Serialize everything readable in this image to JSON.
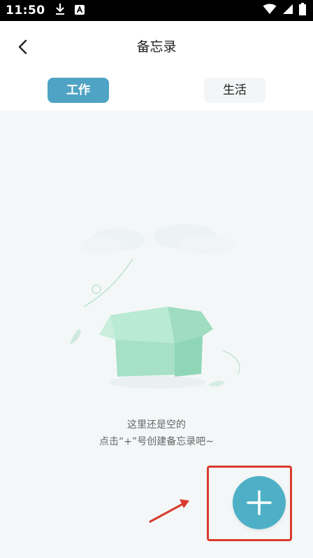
{
  "status_bar": {
    "time": "11:50",
    "icons_left": [
      "download-icon",
      "accessibility-icon"
    ],
    "icons_right": [
      "wifi-icon",
      "signal-icon",
      "battery-icon"
    ]
  },
  "header": {
    "title": "备忘录",
    "back_icon": "chevron-left-icon"
  },
  "tabs": [
    {
      "label": "工作",
      "active": true
    },
    {
      "label": "生活",
      "active": false
    }
  ],
  "empty_state": {
    "line1": "这里还是空的",
    "line2": "点击“+”号创建备忘录吧~"
  },
  "fab": {
    "icon": "plus-icon"
  },
  "colors": {
    "accent": "#4fa3c4",
    "fab": "#4db0c6",
    "background": "#f4f7f8",
    "annotation": "#d93a2b"
  }
}
